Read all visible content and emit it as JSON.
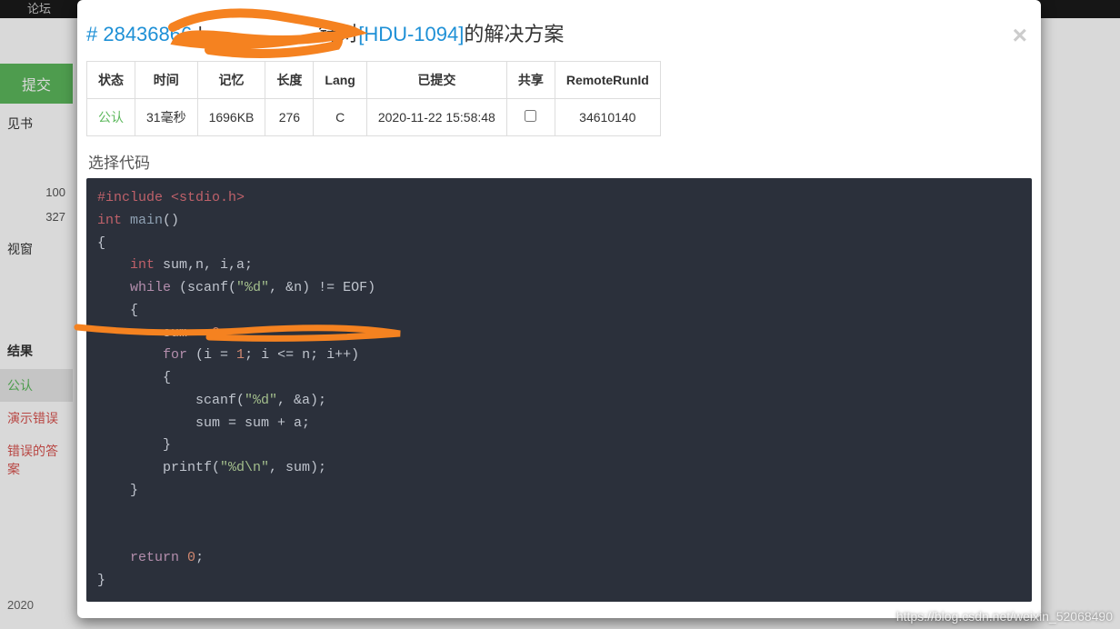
{
  "background": {
    "top_nav_item": "论坛",
    "submit_button": "提交",
    "sidebar_items": [
      "见书"
    ],
    "sidebar_numbers": [
      "100",
      "327"
    ],
    "sidebar_text": "视窗",
    "result_label": "结果",
    "result_accepted": "公认",
    "result_demo_error": "演示错误",
    "result_wrong_answer": "错误的答案",
    "footer": "2020"
  },
  "modal": {
    "title_hash": "# 28436866",
    "title_sep": " | ",
    "title_target_prefix": "针对",
    "title_problem_link": "[HDU-1094]",
    "title_suffix": "的解决方案",
    "close_icon": "×",
    "table": {
      "headers": [
        "状态",
        "时间",
        "记忆",
        "长度",
        "Lang",
        "已提交",
        "共享",
        "RemoteRunId"
      ],
      "row": {
        "status": "公认",
        "time": "31毫秒",
        "memory": "1696KB",
        "length": "276",
        "lang": "C",
        "submitted": "2020-11-22 15:58:48",
        "shared_checked": false,
        "remote_run_id": "34610140"
      }
    },
    "select_code_label": "选择代码",
    "code": {
      "line1_include": "#include",
      "line1_header": " <stdio.h>",
      "line2_type": "int",
      "line2_func": " main",
      "line2_paren": "()",
      "line3": "{",
      "line4_indent": "    ",
      "line4_type": "int",
      "line4_vars": " sum,n, i,a;",
      "line5_indent": "    ",
      "line5_kw": "while",
      "line5_open": " (scanf(",
      "line5_str": "\"%d\"",
      "line5_mid": ", &n) != ",
      "line5_eof": "EOF",
      "line5_close": ")",
      "line6": "    {",
      "line7_a": "        sum = ",
      "line7_num": "0",
      "line7_b": ";",
      "line8_indent": "        ",
      "line8_kw": "for",
      "line8_a": " (i = ",
      "line8_n1": "1",
      "line8_b": "; i <= n; i++)",
      "line9": "        {",
      "line10_a": "            scanf(",
      "line10_str": "\"%d\"",
      "line10_b": ", &a);",
      "line11": "            sum = sum + a;",
      "line12": "        }",
      "line13_a": "        printf(",
      "line13_str": "\"%d\\n\"",
      "line13_b": ", sum);",
      "line14": "    }",
      "line15": "",
      "line16": "",
      "line17_indent": "    ",
      "line17_kw": "return",
      "line17_sp": " ",
      "line17_num": "0",
      "line17_semi": ";",
      "line18": "}"
    }
  },
  "watermark": "https://blog.csdn.net/weixin_52068490"
}
